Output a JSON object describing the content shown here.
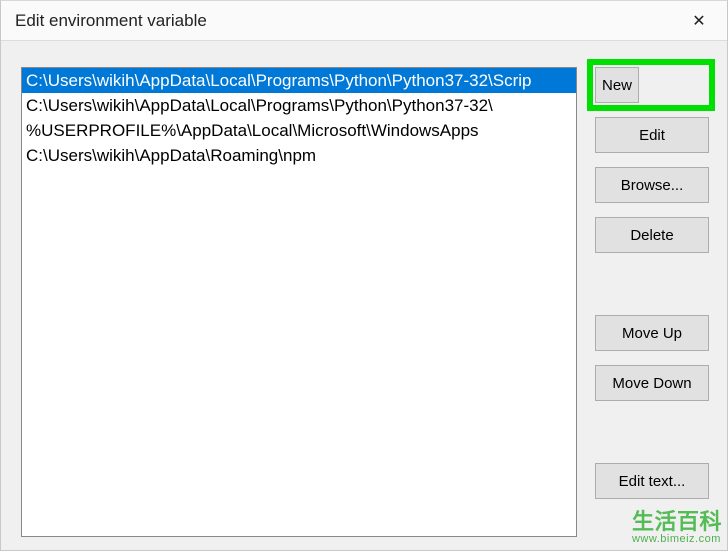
{
  "title": "Edit environment variable",
  "close_label": "✕",
  "entries": [
    {
      "text": "C:\\Users\\wikih\\AppData\\Local\\Programs\\Python\\Python37-32\\Scrip",
      "selected": true
    },
    {
      "text": "C:\\Users\\wikih\\AppData\\Local\\Programs\\Python\\Python37-32\\",
      "selected": false
    },
    {
      "text": "%USERPROFILE%\\AppData\\Local\\Microsoft\\WindowsApps",
      "selected": false
    },
    {
      "text": "C:\\Users\\wikih\\AppData\\Roaming\\npm",
      "selected": false
    }
  ],
  "buttons": {
    "new": "New",
    "edit": "Edit",
    "browse": "Browse...",
    "delete": "Delete",
    "move_up": "Move Up",
    "move_down": "Move Down",
    "edit_text": "Edit text..."
  },
  "watermark": {
    "cn": "生活百科",
    "url": "www.bimeiz.com"
  }
}
